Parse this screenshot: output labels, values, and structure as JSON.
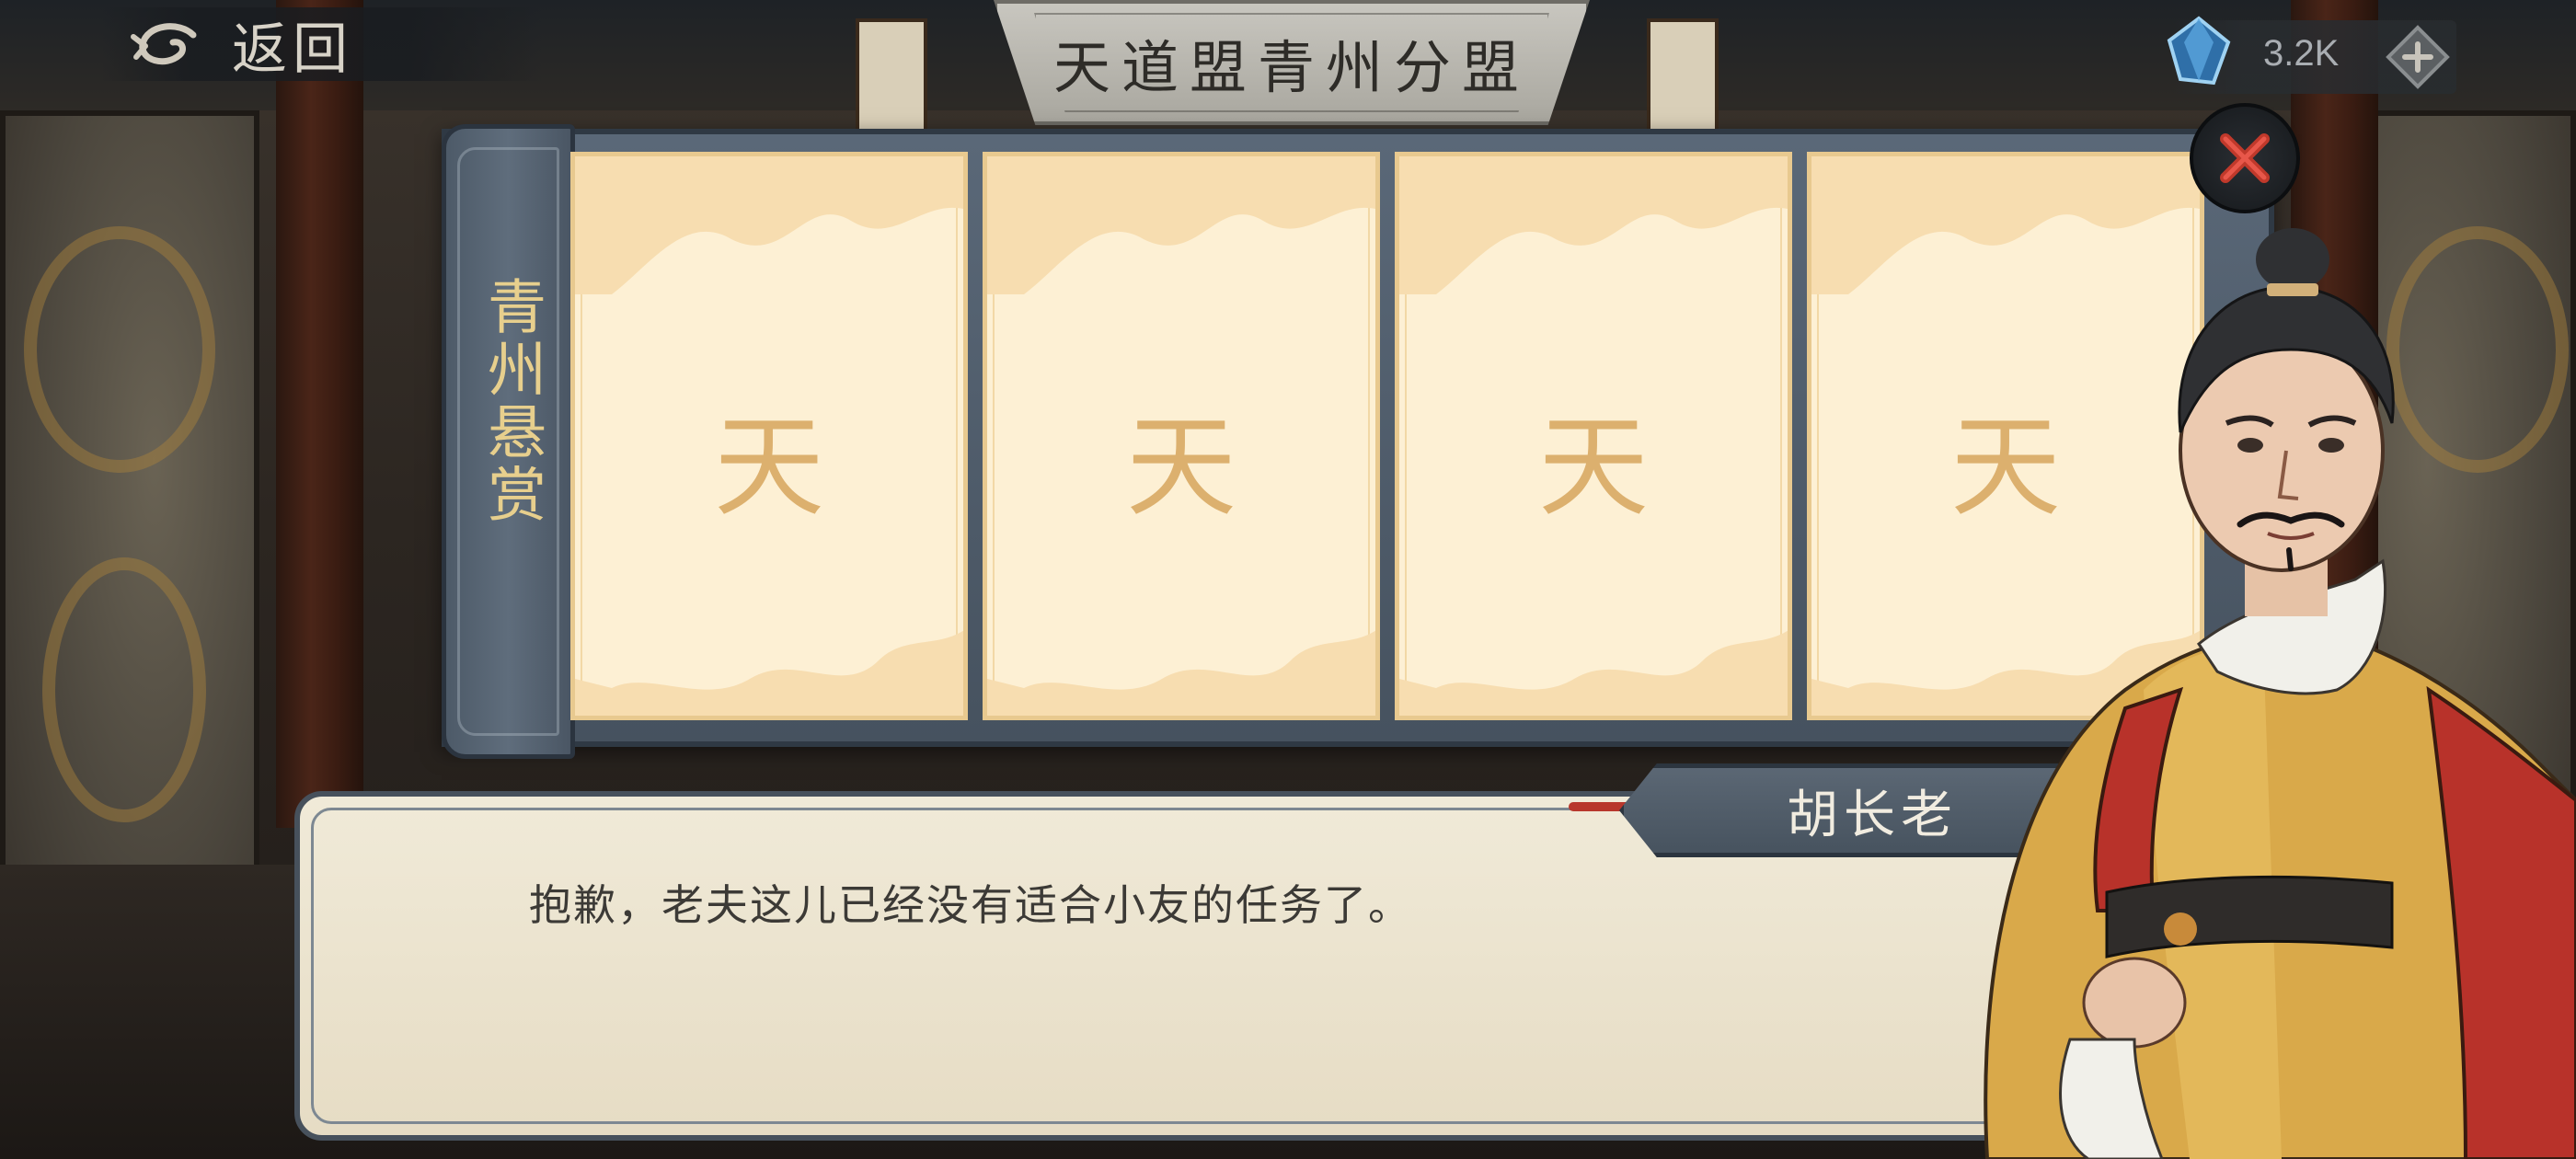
{
  "top_bar": {
    "back_label": "返回",
    "title": "天道盟青州分盟",
    "currency_value": "3.2K",
    "currency_icon": "gem-icon",
    "add_icon": "plus-diamond-icon"
  },
  "board": {
    "title": "青州悬赏",
    "close_icon": "close-x-icon",
    "cards": [
      {
        "glyph": "天"
      },
      {
        "glyph": "天"
      },
      {
        "glyph": "天"
      },
      {
        "glyph": "天"
      }
    ]
  },
  "dialog": {
    "speaker": "胡长老",
    "text": "抱歉，老夫这儿已经没有适合小友的任务了。"
  },
  "colors": {
    "panel": "#56626f",
    "card": "#fdf0d4",
    "card_glyph": "#dcb06e",
    "close_x": "#c0392b",
    "title_gold": "#e7cf8d"
  }
}
